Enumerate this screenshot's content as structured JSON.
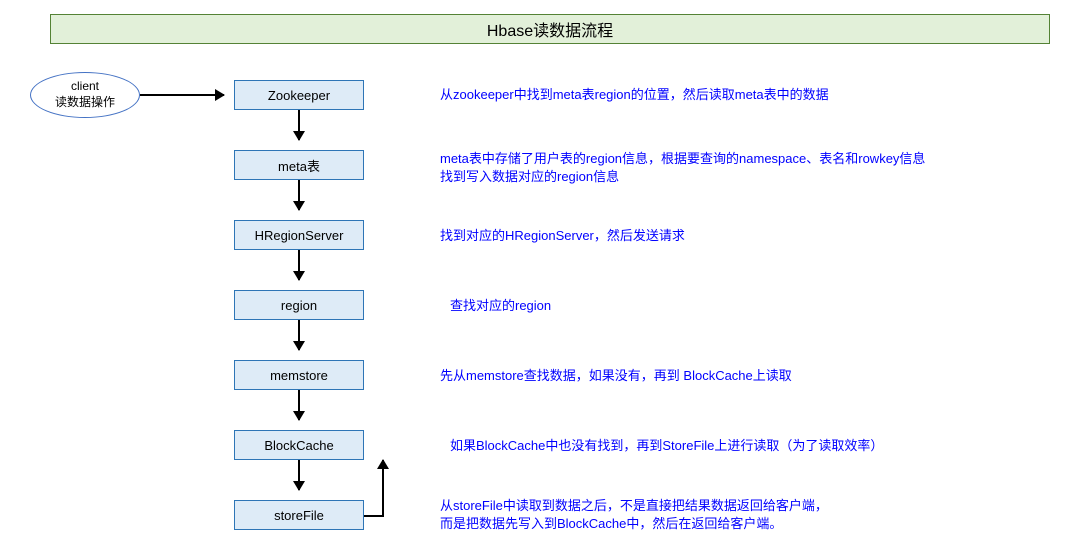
{
  "title": "Hbase读数据流程",
  "client": {
    "line1": "client",
    "line2": "读数据操作"
  },
  "nodes": [
    {
      "label": "Zookeeper",
      "desc": "从zookeeper中找到meta表region的位置，然后读取meta表中的数据"
    },
    {
      "label": "meta表",
      "desc": "meta表中存储了用户表的region信息，根据要查询的namespace、表名和rowkey信息\n找到写入数据对应的region信息"
    },
    {
      "label": "HRegionServer",
      "desc": "找到对应的HRegionServer，然后发送请求"
    },
    {
      "label": "region",
      "desc": "查找对应的region"
    },
    {
      "label": "memstore",
      "desc": "先从memstore查找数据，如果没有，再到 BlockCache上读取"
    },
    {
      "label": "BlockCache",
      "desc": "如果BlockCache中也没有找到，再到StoreFile上进行读取（为了读取效率）"
    },
    {
      "label": "storeFile",
      "desc": "从storeFile中读取到数据之后，不是直接把结果数据返回给客户端，\n而是把数据先写入到BlockCache中，然后在返回给客户端。"
    }
  ]
}
